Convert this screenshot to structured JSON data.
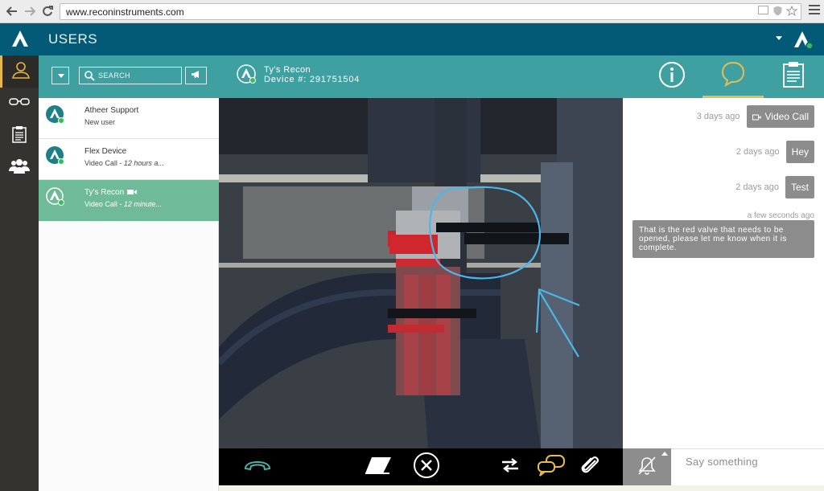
{
  "browser": {
    "back_icon": "back-arrow-icon",
    "forward_icon": "forward-arrow-icon",
    "reload_icon": "reload-icon",
    "url": "www.reconinstruments.com",
    "menu_icon": "hamburger-menu-icon"
  },
  "app": {
    "title": "USERS",
    "logo_icon": "recon-logo-icon",
    "colors": {
      "header": "#035a76",
      "teal": "#3fa0a1",
      "active_row": "#6fba98",
      "accent": "#e8bc52",
      "rail": "#35332f",
      "bubble": "#8c8c8c"
    }
  },
  "rail": {
    "items": [
      {
        "name": "users",
        "icon": "user-icon",
        "active": true
      },
      {
        "name": "devices",
        "icon": "glasses-icon",
        "active": false
      },
      {
        "name": "reports",
        "icon": "clipboard-icon",
        "active": false
      },
      {
        "name": "groups",
        "icon": "group-icon",
        "active": false
      }
    ]
  },
  "list": {
    "search_placeholder": "SEARCH",
    "contacts": [
      {
        "name": "Atheer Support",
        "status": "New user",
        "time": "",
        "video": false,
        "active": false
      },
      {
        "name": "Flex Device",
        "status": "Video Call",
        "time": " - 12 hours a...",
        "video": false,
        "active": false
      },
      {
        "name": "Ty's Recon",
        "status": "Video Call",
        "time": " - 12 minute...",
        "video": true,
        "active": true
      }
    ]
  },
  "conversation": {
    "name": "Ty's Recon",
    "device": "Device #:  291751504",
    "tabs": [
      {
        "name": "info",
        "icon": "info-icon",
        "active": false
      },
      {
        "name": "chat",
        "icon": "chat-bubble-icon",
        "active": true
      },
      {
        "name": "notes",
        "icon": "clipboard-icon",
        "active": false
      }
    ]
  },
  "messages": [
    {
      "time": "3 days ago",
      "text": "Video Call",
      "icon": "video-camera-icon"
    },
    {
      "time": "2 days ago",
      "text": "Hey"
    },
    {
      "time": "2 days ago",
      "text": "Test"
    },
    {
      "time": "a few seconds ago",
      "text": "That is the red valve that needs to be opened, please let me know when it is complete."
    }
  ],
  "controls": {
    "items": [
      {
        "name": "hang-up",
        "icon": "phone-hangup-icon"
      },
      {
        "name": "eraser",
        "icon": "eraser-icon"
      },
      {
        "name": "close",
        "icon": "close-circle-icon"
      },
      {
        "name": "swap",
        "icon": "swap-arrows-icon"
      },
      {
        "name": "chat",
        "icon": "chat-bubbles-icon"
      },
      {
        "name": "attach",
        "icon": "paperclip-icon"
      }
    ]
  },
  "chat_input": {
    "placeholder": "Say something",
    "mute_icon": "notifications-off-icon"
  }
}
